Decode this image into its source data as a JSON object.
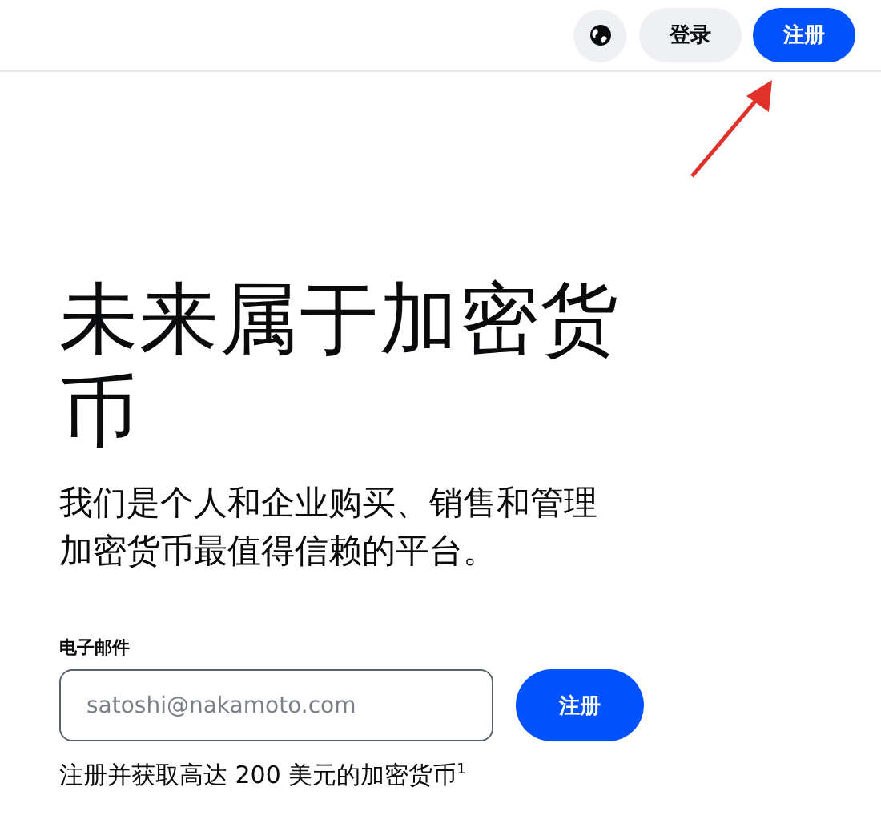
{
  "header": {
    "buttons": [
      {
        "label": "登录",
        "kind": "secondary"
      },
      {
        "label": "注册",
        "kind": "primary"
      }
    ]
  },
  "hero": {
    "title": "未来属于加密货币",
    "subtitle": "我们是个人和企业购买、销售和管理加密货币最值得信赖的平台。"
  },
  "signup": {
    "label": "电子邮件",
    "placeholder": "satoshi@nakamoto.com",
    "button": "注册",
    "note": "注册并获取高达 200 美元的加密货币$^{1}$"
  }
}
